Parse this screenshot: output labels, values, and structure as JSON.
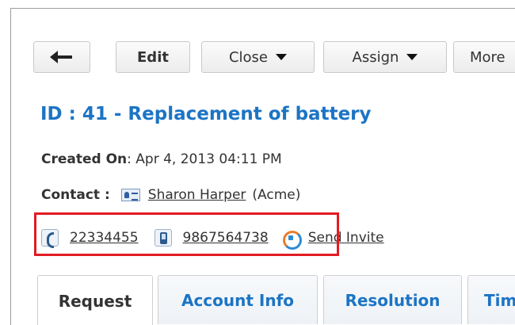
{
  "toolbar": {
    "back_icon": "arrow-left-icon",
    "edit_label": "Edit",
    "close_label": "Close",
    "assign_label": "Assign",
    "more_label": "More"
  },
  "request": {
    "title": "ID : 41 - Replacement of battery",
    "created_label": "Created On",
    "created_value": " : Apr 4, 2013 04:11 PM",
    "contact_label": "Contact :",
    "contact_name": "Sharon Harper",
    "contact_account": "(Acme)",
    "phone": "22334455",
    "mobile": "9867564738",
    "send_invite_label": "Send Invite"
  },
  "tabs": [
    {
      "label": "Request"
    },
    {
      "label": "Account Info"
    },
    {
      "label": "Resolution"
    },
    {
      "label": "Tim"
    }
  ],
  "colors": {
    "accent": "#1c74c4",
    "highlight": "#e21b23"
  }
}
